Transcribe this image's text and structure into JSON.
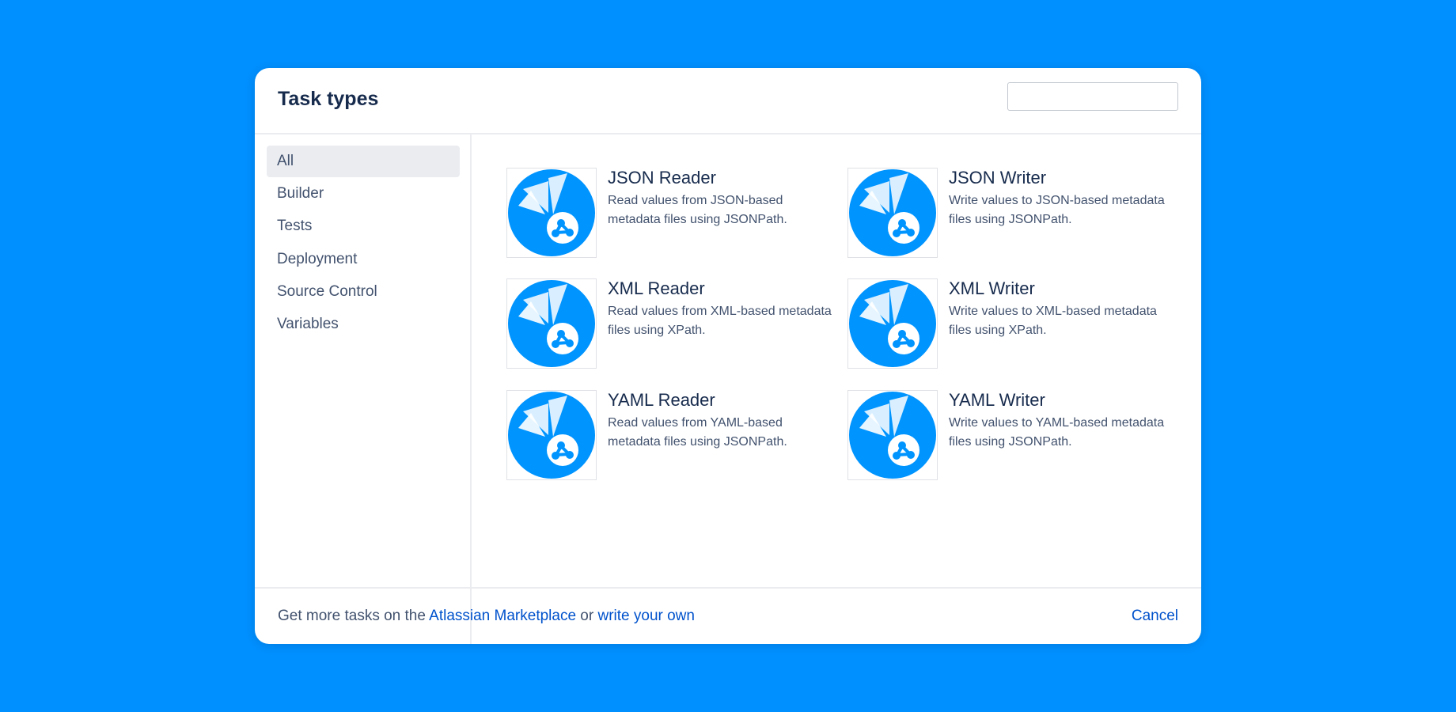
{
  "dialog": {
    "title": "Task types",
    "search": {
      "value": "",
      "placeholder": ""
    }
  },
  "sidebar": {
    "selected": "All",
    "items": [
      {
        "label": "All"
      },
      {
        "label": "Builder"
      },
      {
        "label": "Tests"
      },
      {
        "label": "Deployment"
      },
      {
        "label": "Source Control"
      },
      {
        "label": "Variables"
      }
    ]
  },
  "tasks": [
    {
      "name": "JSON Reader",
      "description": "Read values from JSON-based metadata files using JSONPath.",
      "icon": "metadata-plugin-icon"
    },
    {
      "name": "JSON Writer",
      "description": "Write values to JSON-based metadata files using JSONPath.",
      "icon": "metadata-plugin-icon"
    },
    {
      "name": "XML Reader",
      "description": "Read values from XML-based metadata files using XPath.",
      "icon": "metadata-plugin-icon"
    },
    {
      "name": "XML Writer",
      "description": "Write values to XML-based metadata files using XPath.",
      "icon": "metadata-plugin-icon"
    },
    {
      "name": "YAML Reader",
      "description": "Read values from YAML-based metadata files using JSONPath.",
      "icon": "metadata-plugin-icon"
    },
    {
      "name": "YAML Writer",
      "description": "Write values to YAML-based metadata files using JSONPath.",
      "icon": "metadata-plugin-icon"
    }
  ],
  "footer": {
    "prefix": "Get more tasks on the ",
    "marketplace_link": "Atlassian Marketplace",
    "connector": " or ",
    "write_link": "write your own",
    "cancel": "Cancel"
  },
  "colors": {
    "background": "#0090FF",
    "icon_blue": "#0094FF",
    "link": "#0052CC",
    "text_primary": "#172B4D",
    "text_secondary": "#42526E",
    "selected_bg": "#EBECF0"
  }
}
